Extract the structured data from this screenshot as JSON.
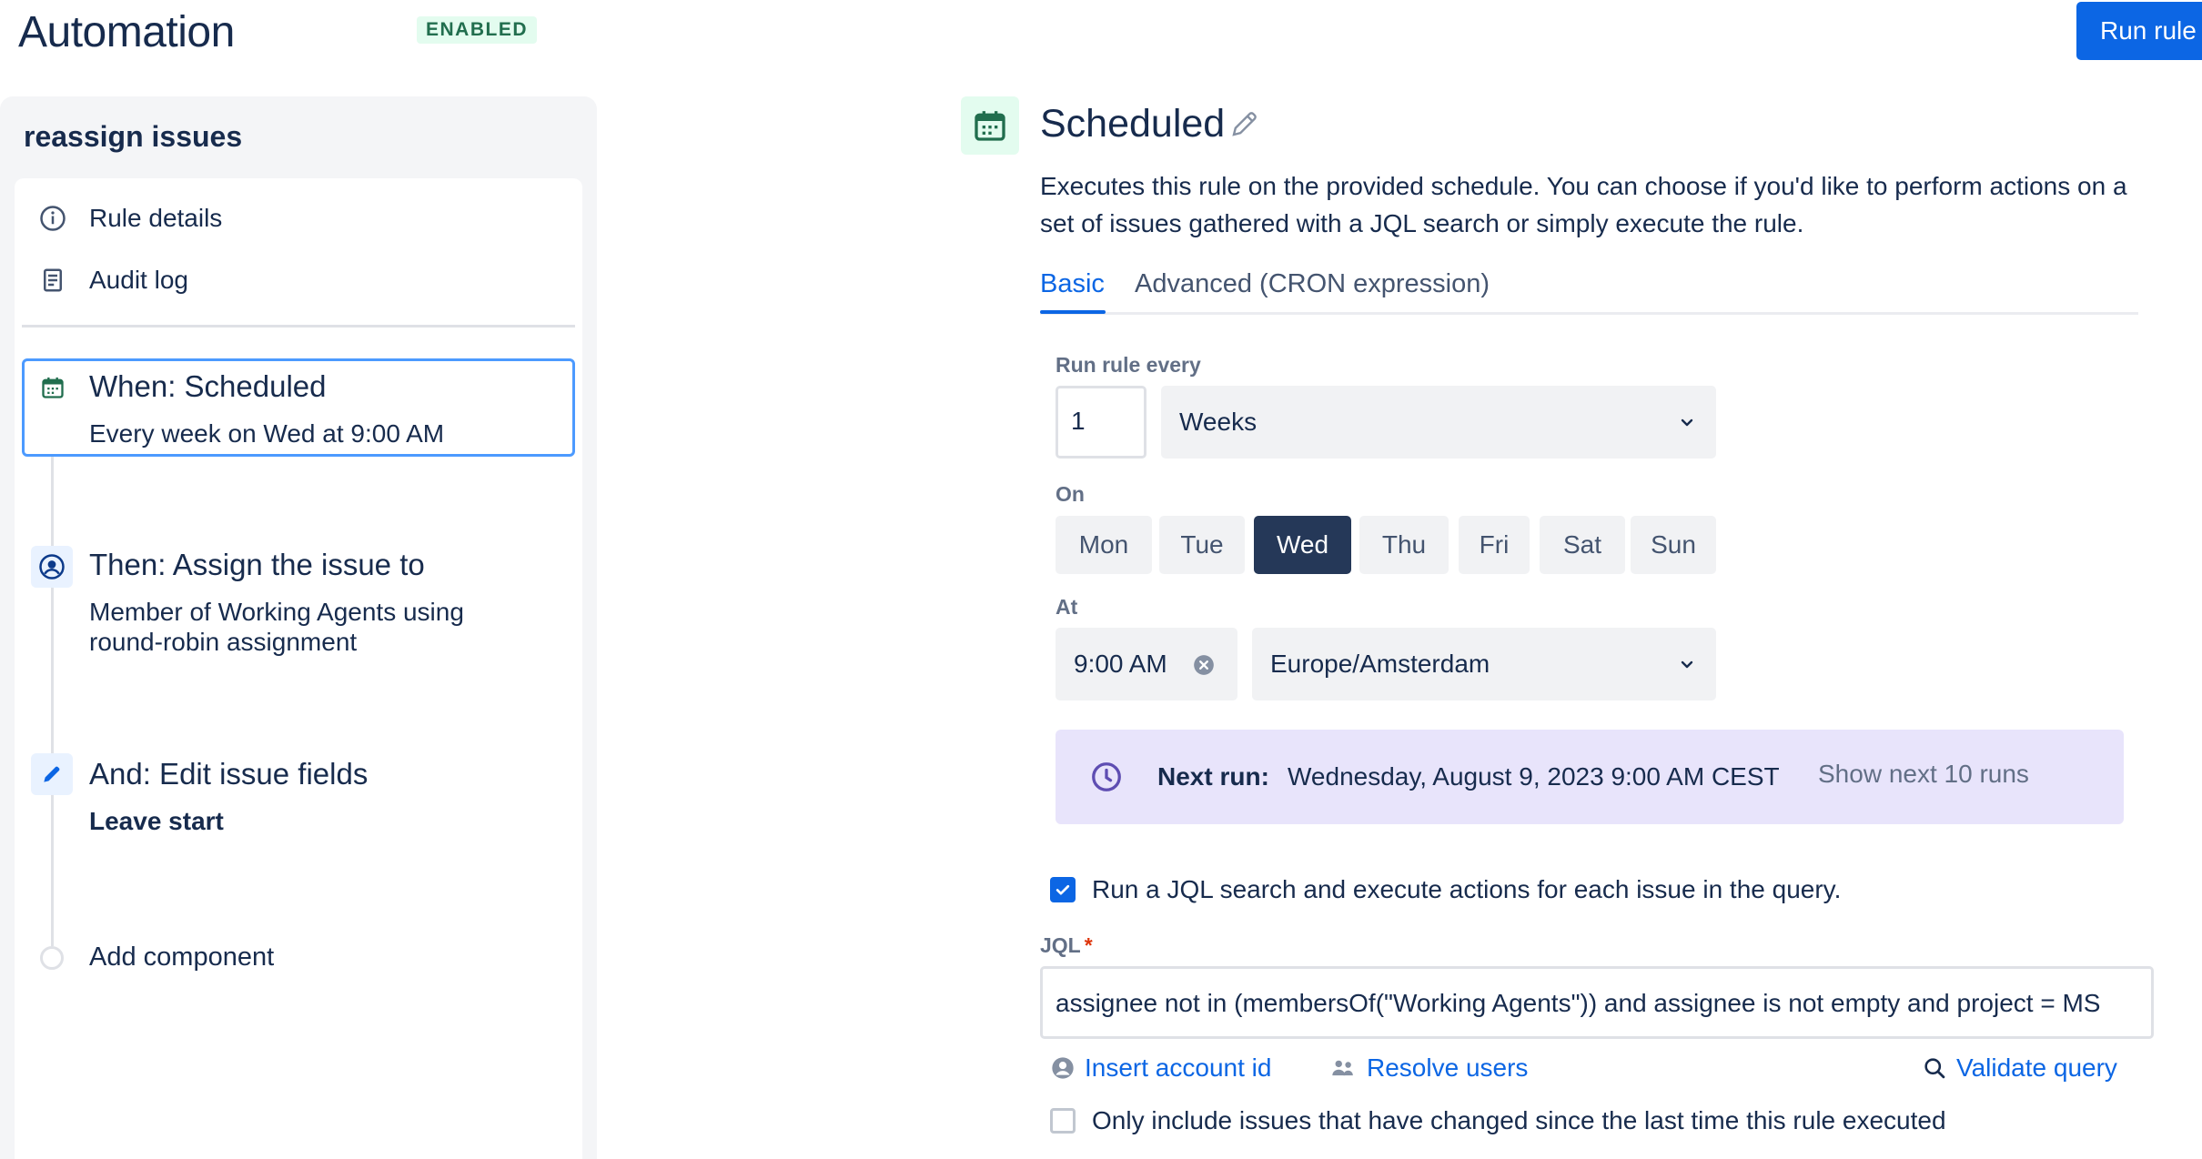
{
  "header": {
    "title": "Automation",
    "status_badge": "ENABLED",
    "run_rule_label": "Run rule"
  },
  "sidebar": {
    "rule_name": "reassign issues",
    "menu": [
      {
        "label": "Rule details",
        "icon": "info-icon"
      },
      {
        "label": "Audit log",
        "icon": "document-icon"
      }
    ],
    "steps": [
      {
        "title": "When: Scheduled",
        "subtitle": "Every week on Wed at 9:00 AM",
        "icon": "calendar-icon",
        "selected": true
      },
      {
        "title": "Then: Assign the issue to",
        "subtitle": "Member of Working Agents using round-robin assignment",
        "icon": "user-circle-icon"
      },
      {
        "title": "And: Edit issue fields",
        "subtitle": "Leave start",
        "icon": "pencil-icon"
      }
    ],
    "add_component_label": "Add component"
  },
  "main": {
    "title": "Scheduled",
    "description": "Executes this rule on the provided schedule. You can choose if you'd like to perform actions on a set of issues gathered with a JQL search or simply execute the rule.",
    "tabs": [
      {
        "label": "Basic",
        "active": true
      },
      {
        "label": "Advanced (CRON expression)",
        "active": false
      }
    ],
    "run_every": {
      "label": "Run rule every",
      "value": "1",
      "unit": "Weeks"
    },
    "on": {
      "label": "On",
      "days": [
        "Mon",
        "Tue",
        "Wed",
        "Thu",
        "Fri",
        "Sat",
        "Sun"
      ],
      "selected": "Wed"
    },
    "at": {
      "label": "At",
      "time": "9:00 AM",
      "timezone": "Europe/Amsterdam"
    },
    "next_run": {
      "label": "Next run:",
      "value": "Wednesday, August 9, 2023 9:00 AM CEST",
      "show_more": "Show next 10 runs"
    },
    "jql_search": {
      "checked": true,
      "label": "Run a JQL search and execute actions for each issue in the query."
    },
    "jql": {
      "label": "JQL",
      "required_marker": "*",
      "value": "assignee not in (membersOf(\"Working Agents\")) and assignee is not empty and project = MS"
    },
    "actions": {
      "insert_account_id": "Insert account id",
      "resolve_users": "Resolve users",
      "validate_query": "Validate query"
    },
    "only_changed": {
      "checked": false,
      "label": "Only include issues that have changed since the last time this rule executed"
    }
  },
  "colors": {
    "primary": "#0c66e4",
    "selected_day": "#253858",
    "next_run_bg": "#e8e4fb",
    "badge_bg": "#e3fcef",
    "badge_text": "#216e4e"
  }
}
